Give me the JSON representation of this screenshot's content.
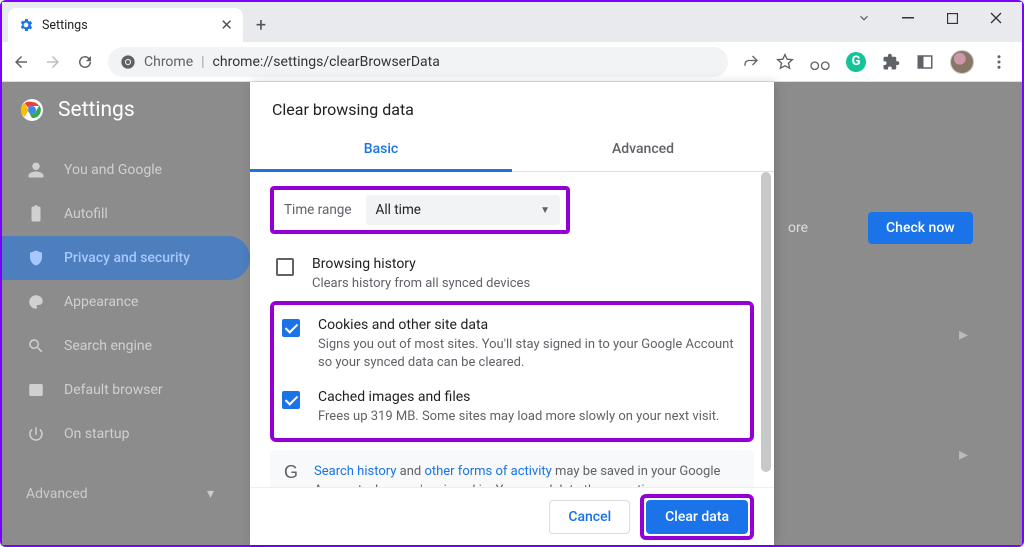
{
  "window": {
    "tab_title": "Settings",
    "new_tab": "+"
  },
  "toolbar": {
    "addr_prefix": "Chrome",
    "url": "chrome://settings/clearBrowserData"
  },
  "page": {
    "title": "Settings",
    "sidebar": [
      {
        "label": "You and Google"
      },
      {
        "label": "Autofill"
      },
      {
        "label": "Privacy and security"
      },
      {
        "label": "Appearance"
      },
      {
        "label": "Search engine"
      },
      {
        "label": "Default browser"
      },
      {
        "label": "On startup"
      }
    ],
    "advanced_label": "Advanced",
    "right": {
      "more": "ore",
      "check_now": "Check now"
    }
  },
  "dialog": {
    "title": "Clear browsing data",
    "tabs": {
      "basic": "Basic",
      "advanced": "Advanced"
    },
    "time_label": "Time range",
    "time_value": "All time",
    "options": {
      "history": {
        "title": "Browsing history",
        "desc": "Clears history from all synced devices"
      },
      "cookies": {
        "title": "Cookies and other site data",
        "desc": "Signs you out of most sites. You'll stay signed in to your Google Account so your synced data can be cleared."
      },
      "cache": {
        "title": "Cached images and files",
        "desc": "Frees up 319 MB. Some sites may load more slowly on your next visit."
      }
    },
    "info": {
      "link1": "Search history",
      "mid1": " and ",
      "link2": "other forms of activity",
      "rest": " may be saved in your Google Account when you're signed in. You can delete them anytime."
    },
    "buttons": {
      "cancel": "Cancel",
      "clear": "Clear data"
    }
  }
}
